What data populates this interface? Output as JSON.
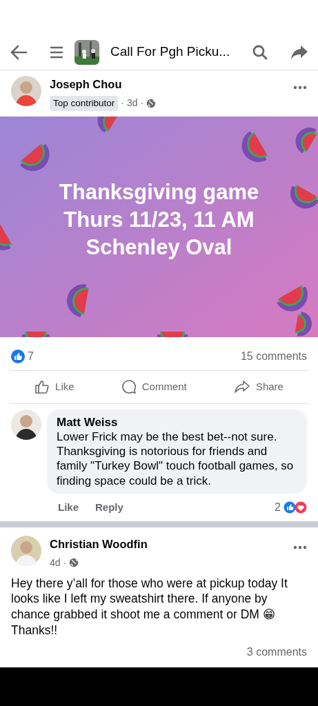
{
  "header": {
    "title": "Call For Pgh Picku..."
  },
  "separator": "·",
  "posts": [
    {
      "author": "Joseph Chou",
      "badge": "Top contributor",
      "time": "3d",
      "card_lines": [
        "Thanksgiving game",
        "Thurs 11/23, 11 AM",
        "Schenley Oval"
      ],
      "reaction_count": "7",
      "comments_count": "15 comments",
      "actions": [
        "Like",
        "Comment",
        "Share"
      ],
      "comment": {
        "author": "Matt Weiss",
        "text": "Lower Frick may be the best bet--not sure. Thanksgiving is notorious for friends and family \"Turkey Bowl\" touch football games, so finding space could be a trick.",
        "actions": [
          "Like",
          "Reply"
        ],
        "reaction_count": "2"
      }
    },
    {
      "author": "Christian Woodfin",
      "time": "4d",
      "text": "Hey there y’all for those who were at pickup today It looks like I left my sweatshirt there. If anyone by chance grabbed it shoot me a comment or DM 😁 Thanks!!",
      "comments_count": "3 comments"
    }
  ]
}
